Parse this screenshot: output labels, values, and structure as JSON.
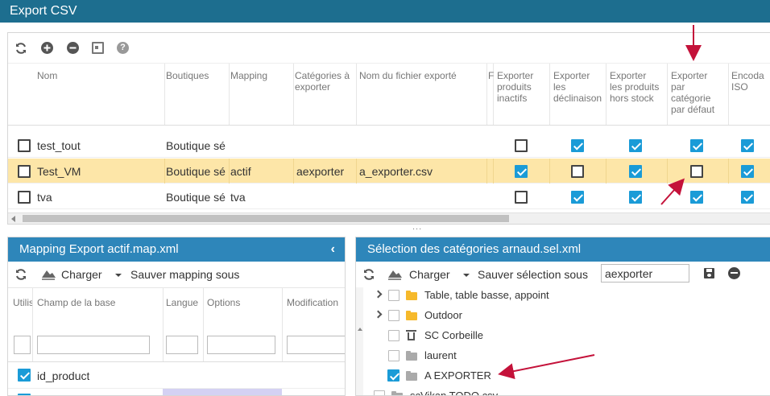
{
  "window": {
    "title": "Export CSV"
  },
  "grid": {
    "toolbar": [
      "refresh-icon",
      "add-icon",
      "remove-icon",
      "export-icon",
      "help-icon"
    ],
    "headers": {
      "nom": "Nom",
      "boutiques": "Boutiques",
      "mapping": "Mapping",
      "categories_l1": "Catégories à",
      "categories_l2": "exporter",
      "fichier": "Nom du fichier exporté",
      "f": "F",
      "inactifs_l1": "Exporter",
      "inactifs_l2": "produits",
      "inactifs_l3": "inactifs",
      "declinaisons_l1": "Exporter",
      "declinaisons_l2": "les",
      "declinaisons_l3": "déclinaison",
      "horsstock_l1": "Exporter",
      "horsstock_l2": "les produits",
      "horsstock_l3": "hors stock",
      "parcat_l1": "Exporter",
      "parcat_l2": "par",
      "parcat_l3": "catégorie",
      "parcat_l4": "par défaut",
      "iso_l1": "Encoda",
      "iso_l2": "ISO"
    },
    "rows": [
      {
        "nom": "test_tout",
        "boutiques": "Boutique sé",
        "mapping": "",
        "categories": "",
        "fichier": "",
        "checked": false,
        "inactifs": false,
        "declinaisons": true,
        "horsstock": true,
        "parcat": true,
        "iso": true
      },
      {
        "nom": "Test_VM",
        "boutiques": "Boutique sé",
        "mapping": "actif",
        "categories": "aexporter",
        "fichier": "a_exporter.csv",
        "checked": false,
        "inactifs": true,
        "declinaisons": false,
        "horsstock": true,
        "parcat": false,
        "iso": true
      },
      {
        "nom": "tva",
        "boutiques": "Boutique sé",
        "mapping": "tva",
        "categories": "",
        "fichier": "",
        "checked": false,
        "inactifs": false,
        "declinaisons": true,
        "horsstock": true,
        "parcat": true,
        "iso": true
      }
    ],
    "splitter": "..."
  },
  "mapping_panel": {
    "title": "Mapping Export actif.map.xml",
    "collapse_icon": "chevron-left-icon",
    "charger": "Charger",
    "sauver": "Sauver mapping sous",
    "headers": {
      "utilise": "Utilis",
      "champ": "Champ de la base",
      "langue": "Langue",
      "options": "Options",
      "modification": "Modification"
    },
    "rows": [
      {
        "checked": true,
        "champ": "id_product"
      }
    ]
  },
  "categories_panel": {
    "title": "Sélection des catégories arnaud.sel.xml",
    "charger": "Charger",
    "sauver": "Sauver sélection sous",
    "search_value": "aexporter",
    "tree": [
      {
        "label": "Table, table basse, appoint",
        "expandable": true,
        "icon": "folder-icon",
        "checked": false
      },
      {
        "label": "Outdoor",
        "expandable": true,
        "icon": "folder-icon",
        "checked": false
      },
      {
        "label": "SC Corbeille",
        "expandable": false,
        "icon": "trash-icon",
        "checked": false
      },
      {
        "label": "laurent",
        "expandable": false,
        "icon": "folder-gray-icon",
        "checked": false
      },
      {
        "label": "A EXPORTER",
        "expandable": false,
        "icon": "folder-gray-icon",
        "checked": true
      },
      {
        "label": "scVikan TODO.csv",
        "expandable": false,
        "icon": "folder-gray-icon",
        "checked": false
      }
    ]
  },
  "colors": {
    "titlebar": "#1d6e8f",
    "panel_head": "#2e86ba",
    "selected_row": "#fde6a8",
    "checkbox": "#1a9bd7",
    "annotation": "#c4123a"
  }
}
